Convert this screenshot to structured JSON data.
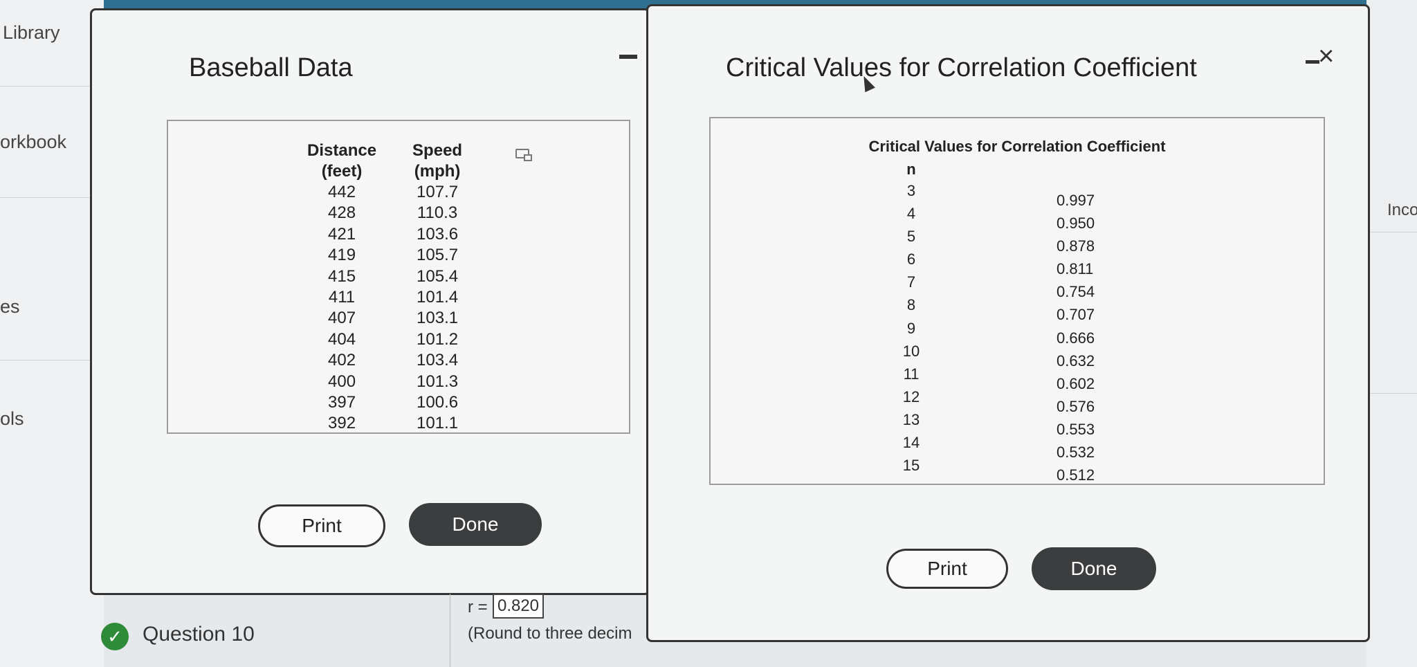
{
  "sidebar": {
    "items": [
      {
        "label": "Library"
      },
      {
        "label": "orkbook"
      },
      {
        "label": "es"
      },
      {
        "label": "ols"
      }
    ]
  },
  "right_strip": {
    "label": "Inco"
  },
  "baseball_window": {
    "title": "Baseball Data",
    "headers": [
      {
        "line1": "Distance",
        "line2": "(feet)"
      },
      {
        "line1": "Speed",
        "line2": "(mph)"
      }
    ],
    "rows": [
      [
        "442",
        "107.7"
      ],
      [
        "428",
        "110.3"
      ],
      [
        "421",
        "103.6"
      ],
      [
        "419",
        "105.7"
      ],
      [
        "415",
        "105.4"
      ],
      [
        "411",
        "101.4"
      ],
      [
        "407",
        "103.1"
      ],
      [
        "404",
        "101.2"
      ],
      [
        "402",
        "103.4"
      ],
      [
        "400",
        "101.3"
      ],
      [
        "397",
        "100.6"
      ],
      [
        "392",
        "101.1"
      ]
    ],
    "print_label": "Print",
    "done_label": "Done"
  },
  "critical_window": {
    "title": "Critical Values for Correlation Coefficient",
    "caption": "Critical Values for Correlation Coefficient",
    "n_header": "n",
    "rows": [
      [
        "3",
        "0.997"
      ],
      [
        "4",
        "0.950"
      ],
      [
        "5",
        "0.878"
      ],
      [
        "6",
        "0.811"
      ],
      [
        "7",
        "0.754"
      ],
      [
        "8",
        "0.707"
      ],
      [
        "9",
        "0.666"
      ],
      [
        "10",
        "0.632"
      ],
      [
        "11",
        "0.602"
      ],
      [
        "12",
        "0.576"
      ],
      [
        "13",
        "0.553"
      ],
      [
        "14",
        "0.532"
      ],
      [
        "15",
        "0.512"
      ]
    ],
    "print_label": "Print",
    "done_label": "Done",
    "close_glyph": "×"
  },
  "question": {
    "label": "Question 10",
    "r_label": "r =",
    "r_value": "0.820",
    "hint": "(Round to three decim"
  },
  "colors": {
    "check_green": "#2f8a3a",
    "done_button": "#3b3d3f",
    "top_band": "#2f6f8f"
  }
}
